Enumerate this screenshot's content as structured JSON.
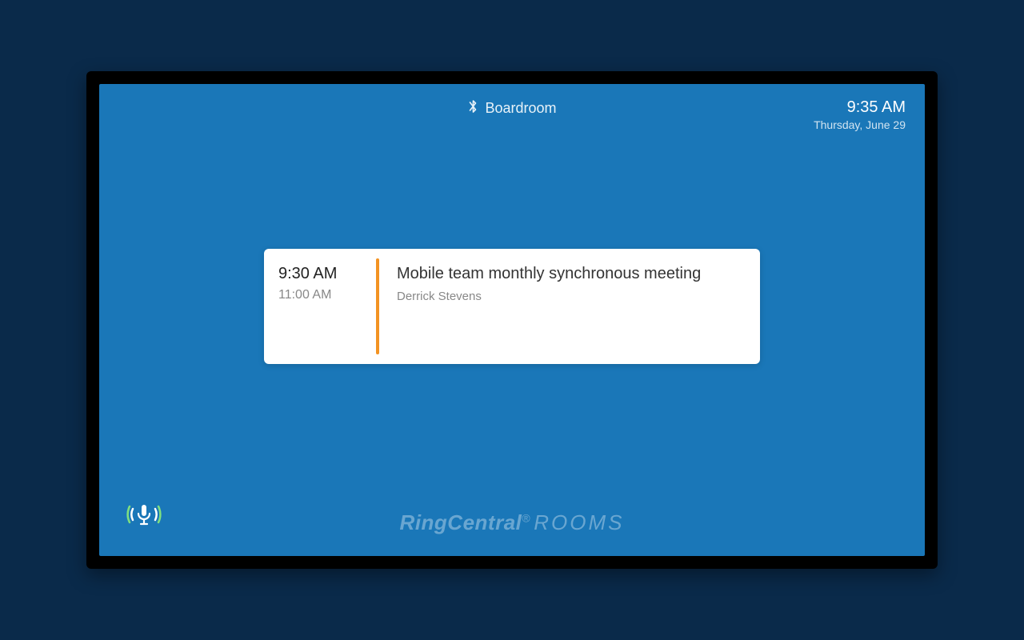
{
  "header": {
    "room_name": "Boardroom",
    "time": "9:35 AM",
    "date": "Thursday, June 29"
  },
  "meeting": {
    "start_time": "9:30 AM",
    "end_time": "11:00 AM",
    "title": "Mobile team monthly synchronous meeting",
    "organizer": "Derrick Stevens"
  },
  "brand": {
    "name": "RingCentral",
    "suffix": "ROOMS"
  }
}
